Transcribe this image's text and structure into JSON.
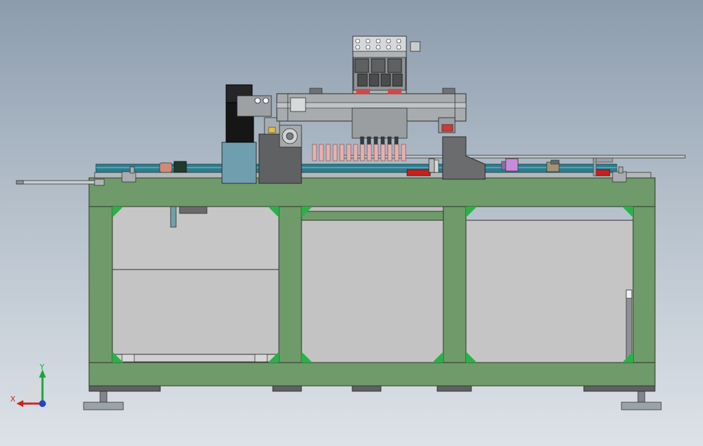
{
  "triad": {
    "x_label": "X",
    "y_label": "Y",
    "colors": {
      "x": "#cc2222",
      "y": "#1ea33a",
      "z": "#2244cc"
    }
  },
  "colors": {
    "background_top": "#8c9cae",
    "background_bottom": "#dde2e8",
    "frame": "#6f9a6a",
    "frame_edge": "#3b4a3a",
    "gusset": "#2bb04a",
    "panel": "#c4c4c4",
    "metal": "#a8acae",
    "dark_metal": "#5e6061",
    "motor": "#161616",
    "teal_block": "#6f9faf",
    "conveyor": "#2f7d8e",
    "red_part": "#cc2020",
    "pink_part": "#e8b0b0",
    "purple_part": "#c78cd9",
    "foot": "#9aa2aa"
  }
}
